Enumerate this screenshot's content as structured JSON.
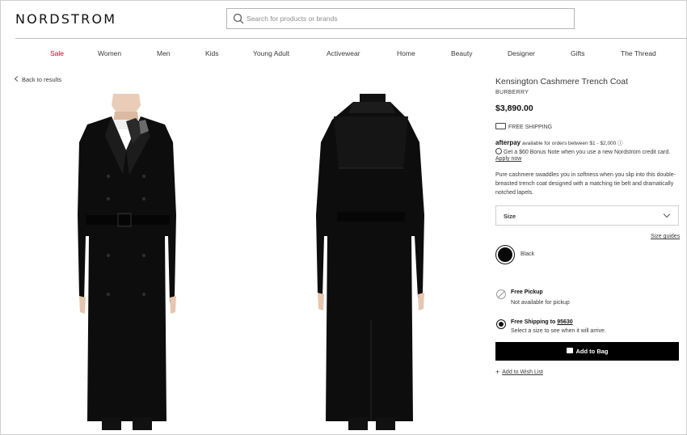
{
  "header": {
    "logo": "NORDSTROM",
    "search_placeholder": "Search for products or brands"
  },
  "nav": {
    "items": [
      "Sale",
      "Women",
      "Men",
      "Kids",
      "Young Adult",
      "Activewear",
      "Home",
      "Beauty",
      "Designer",
      "Gifts",
      "The Thread"
    ]
  },
  "back_link": "Back to results",
  "product": {
    "title": "Kensington Cashmere Trench Coat",
    "brand": "BURBERRY",
    "price": "$3,890.00",
    "free_shipping": "FREE SHIPPING",
    "afterpay_brand": "afterpay",
    "afterpay_text": "available for orders between $1 - $2,000",
    "bonus_note": "Get a $60 Bonus Note when you use a new Nordstrom credit card.",
    "apply_now": "Apply now",
    "description": "Pure cashmere swaddles you in softness when you slip into this double-breasted trench coat designed with a matching tie belt and dramatically notched lapels.",
    "size_label": "Size",
    "size_guides": "Size guides",
    "color": "Black",
    "pickup_title": "Free Pickup",
    "pickup_sub": "Not available for pickup",
    "shipping_title": "Free Shipping to",
    "shipping_zip": "95630",
    "shipping_sub": "Select a size to see when it will arrive.",
    "add_to_bag": "Add to Bag",
    "wish_list": "Add to Wish List"
  },
  "colors": {
    "sale_red": "#d0021b",
    "button_black": "#000000",
    "text": "#393939"
  }
}
